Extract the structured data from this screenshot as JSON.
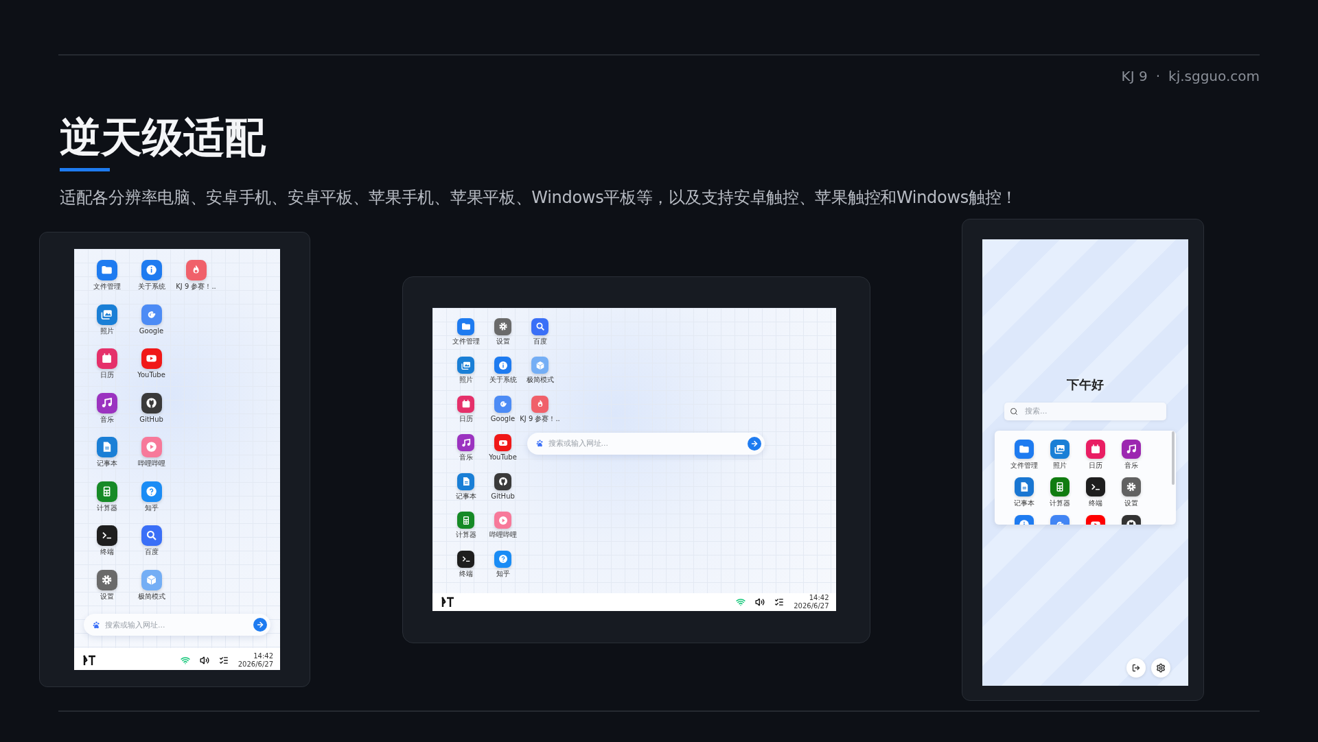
{
  "header": {
    "brand": "KJ 9",
    "separator": "·",
    "site": "kj.sgguo.com",
    "title": "逆天级适配",
    "subtitle": "适配各分辨率电脑、安卓手机、安卓平板、苹果手机、苹果平板、Windows平板等，以及支持安卓触控、苹果触控和Windows触控！"
  },
  "devices": [
    {
      "kind": "phone",
      "apps": [
        {
          "label": "文件管理",
          "kind": "folder",
          "color": "#1e7bf0"
        },
        {
          "label": "照片",
          "kind": "photo",
          "color": "#1a7fd6"
        },
        {
          "label": "日历",
          "kind": "calendar",
          "color": "#e5306a"
        },
        {
          "label": "音乐",
          "kind": "music",
          "color": "#9b33c0"
        },
        {
          "label": "记事本",
          "kind": "note",
          "color": "#1a7fd6"
        },
        {
          "label": "计算器",
          "kind": "calc",
          "color": "#168a26"
        },
        {
          "label": "终端",
          "kind": "terminal",
          "color": "#1e1e1e"
        },
        {
          "label": "设置",
          "kind": "settings",
          "color": "#6a6a6a"
        },
        {
          "label": "关于系统",
          "kind": "info",
          "color": "#1e7bf0"
        },
        {
          "label": "Google",
          "kind": "google",
          "color": "#4c8bf5"
        },
        {
          "label": "YouTube",
          "kind": "youtube",
          "color": "#f01818"
        },
        {
          "label": "GitHub",
          "kind": "github",
          "color": "#3a3a3a"
        },
        {
          "label": "哔哩哔哩",
          "kind": "bili",
          "color": "#f7799a"
        },
        {
          "label": "知乎",
          "kind": "zhihu",
          "color": "#1a8cf5"
        },
        {
          "label": "百度",
          "kind": "search",
          "color": "#3a6ff7"
        },
        {
          "label": "极简模式",
          "kind": "cube",
          "color": "#74aef5"
        },
        {
          "label": "KJ 9 参赛！..",
          "kind": "flame",
          "color": "#f0606a"
        }
      ],
      "search": {
        "placeholder": "搜索或输入网址..."
      },
      "taskbar": {
        "time": "14:42",
        "date": "2026/6/27"
      }
    },
    {
      "kind": "tablet",
      "apps": [
        {
          "label": "文件管理",
          "kind": "folder",
          "color": "#1e7bf0"
        },
        {
          "label": "照片",
          "kind": "photo",
          "color": "#1a7fd6"
        },
        {
          "label": "日历",
          "kind": "calendar",
          "color": "#e5306a"
        },
        {
          "label": "音乐",
          "kind": "music",
          "color": "#9b33c0"
        },
        {
          "label": "记事本",
          "kind": "note",
          "color": "#1a7fd6"
        },
        {
          "label": "计算器",
          "kind": "calc",
          "color": "#168a26"
        },
        {
          "label": "终端",
          "kind": "terminal",
          "color": "#1e1e1e"
        },
        {
          "label": "设置",
          "kind": "settings",
          "color": "#6a6a6a"
        },
        {
          "label": "关于系统",
          "kind": "info",
          "color": "#1e7bf0"
        },
        {
          "label": "Google",
          "kind": "google",
          "color": "#4c8bf5"
        },
        {
          "label": "YouTube",
          "kind": "youtube",
          "color": "#f01818"
        },
        {
          "label": "GitHub",
          "kind": "github",
          "color": "#3a3a3a"
        },
        {
          "label": "哔哩哔哩",
          "kind": "bili",
          "color": "#f7799a"
        },
        {
          "label": "知乎",
          "kind": "zhihu",
          "color": "#1a8cf5"
        },
        {
          "label": "百度",
          "kind": "search",
          "color": "#3a6ff7"
        },
        {
          "label": "极简模式",
          "kind": "cube",
          "color": "#74aef5"
        },
        {
          "label": "KJ 9 参赛！..",
          "kind": "flame",
          "color": "#f0606a"
        }
      ],
      "search": {
        "placeholder": "搜索或输入网址..."
      },
      "taskbar": {
        "time": "14:42",
        "date": "2026/6/27"
      }
    },
    {
      "kind": "launcher",
      "greeting": "下午好",
      "search": {
        "placeholder": "搜索..."
      },
      "apps": [
        {
          "label": "文件管理",
          "kind": "folder",
          "color": "#1e7bf0"
        },
        {
          "label": "照片",
          "kind": "photo",
          "color": "#1a7fd6"
        },
        {
          "label": "日历",
          "kind": "calendar",
          "color": "#e91e63"
        },
        {
          "label": "音乐",
          "kind": "music",
          "color": "#9c27b0"
        },
        {
          "label": "记事本",
          "kind": "note",
          "color": "#1976d2"
        },
        {
          "label": "计算器",
          "kind": "calc",
          "color": "#107c10"
        },
        {
          "label": "终端",
          "kind": "terminal",
          "color": "#1e1e1e"
        },
        {
          "label": "设置",
          "kind": "settings",
          "color": "#616161"
        },
        {
          "kind": "info",
          "color": "#1e7bf0"
        },
        {
          "kind": "google",
          "color": "#4285f4"
        },
        {
          "kind": "youtube",
          "color": "#ff0000"
        },
        {
          "kind": "github",
          "color": "#333333"
        }
      ]
    }
  ]
}
